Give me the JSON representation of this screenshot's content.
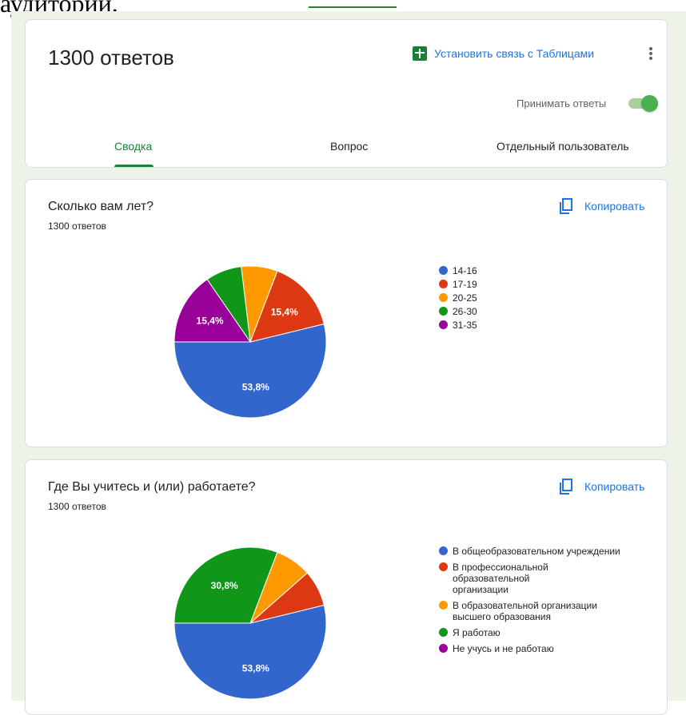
{
  "doc": {
    "top_text": "аудитории."
  },
  "summary": {
    "title": "1300 ответов",
    "link_sheets": "Установить связь с Таблицами",
    "accept_label": "Принимать ответы",
    "accept_on": true,
    "tabs": [
      "Сводка",
      "Вопрос",
      "Отдельный пользователь"
    ],
    "active_tab": "Сводка"
  },
  "copy_label": "Копировать",
  "colors": {
    "accent": "#188038",
    "link": "#1a73e8",
    "blue": "#3366cc",
    "red": "#dc3912",
    "orange": "#ff9900",
    "green": "#109618",
    "purple": "#990099"
  },
  "questions": [
    {
      "title": "Сколько вам лет?",
      "count": "1300 ответов",
      "chart_data": {
        "type": "pie",
        "labels": [
          "14-16",
          "17-19",
          "20-25",
          "26-30",
          "31-35"
        ],
        "values": [
          53.8,
          15.4,
          7.7,
          7.7,
          15.4
        ],
        "slice_labels": [
          "53,8%",
          "15,4%",
          "",
          "",
          "15,4%"
        ],
        "colors": [
          "#3366cc",
          "#dc3912",
          "#ff9900",
          "#109618",
          "#990099"
        ]
      }
    },
    {
      "title": "Где Вы учитесь и (или) работаете?",
      "count": "1300 ответов",
      "chart_data": {
        "type": "pie",
        "labels": [
          "В общеобразовательном учреждении",
          "В профессиональной образовательной организации",
          "В образовательной организации высшего образования",
          "Я работаю",
          "Не учусь и не работаю"
        ],
        "values": [
          53.8,
          7.7,
          7.7,
          30.8,
          0
        ],
        "slice_labels": [
          "53,8%",
          "",
          "",
          "30,8%",
          ""
        ],
        "colors": [
          "#3366cc",
          "#dc3912",
          "#ff9900",
          "#109618",
          "#990099"
        ]
      }
    }
  ]
}
